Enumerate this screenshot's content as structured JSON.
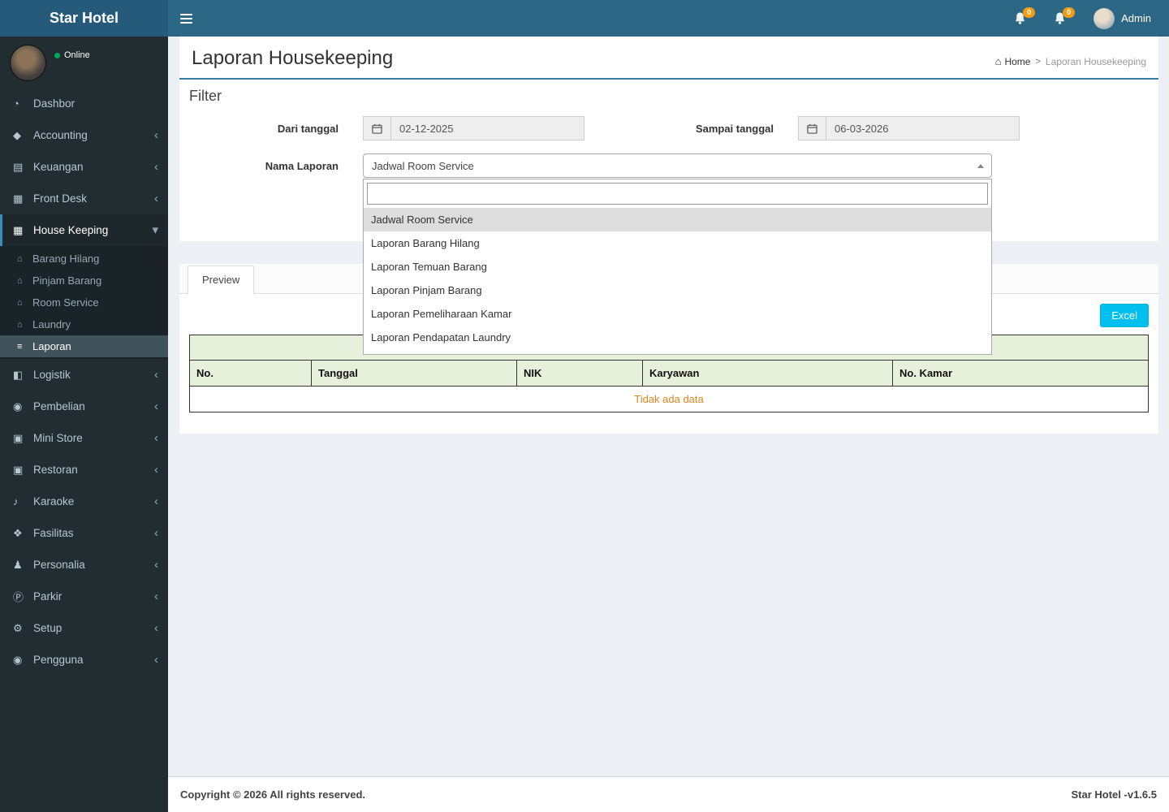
{
  "navbar": {
    "brand": "Star Hotel",
    "notifications": [
      {
        "count": "0"
      },
      {
        "count": "0"
      }
    ],
    "user_label": "Admin"
  },
  "sidebar": {
    "online_label": "Online",
    "items_top": [
      {
        "label": "Dashbor",
        "glyph": "◔",
        "chevron": ""
      },
      {
        "label": "Accounting",
        "glyph": "◆",
        "chevron": "‹"
      },
      {
        "label": "Keuangan",
        "glyph": "▤",
        "chevron": "‹"
      },
      {
        "label": "Front Desk",
        "glyph": "▦",
        "chevron": "‹"
      }
    ],
    "housekeeping": {
      "label": "House Keeping",
      "glyph": "▦",
      "chevron": "▾"
    },
    "housekeeping_children": [
      {
        "label": "Barang Hilang",
        "glyph": "⌂"
      },
      {
        "label": "Pinjam Barang",
        "glyph": "⌂"
      },
      {
        "label": "Room Service",
        "glyph": "⌂"
      },
      {
        "label": "Laundry",
        "glyph": "⌂"
      },
      {
        "label": "Laporan",
        "glyph": "≡",
        "active": true
      }
    ],
    "items_bottom": [
      {
        "label": "Logistik",
        "glyph": "◧",
        "chevron": "‹"
      },
      {
        "label": "Pembelian",
        "glyph": "◉",
        "chevron": "‹"
      },
      {
        "label": "Mini Store",
        "glyph": "▣",
        "chevron": "‹"
      },
      {
        "label": "Restoran",
        "glyph": "▣",
        "chevron": "‹"
      },
      {
        "label": "Karaoke",
        "glyph": "♪",
        "chevron": "‹"
      },
      {
        "label": "Fasilitas",
        "glyph": "❖",
        "chevron": "‹"
      },
      {
        "label": "Personalia",
        "glyph": "♟",
        "chevron": "‹"
      },
      {
        "label": "Parkir",
        "glyph": "Ⓟ",
        "chevron": "‹"
      },
      {
        "label": "Setup",
        "glyph": "⚙",
        "chevron": "‹"
      },
      {
        "label": "Pengguna",
        "glyph": "◉",
        "chevron": "‹"
      }
    ]
  },
  "page": {
    "title": "Laporan Housekeeping",
    "breadcrumb": {
      "home": "Home",
      "separator": ">",
      "current": "Laporan Housekeeping"
    }
  },
  "filter": {
    "title": "Filter",
    "from_label": "Dari tanggal",
    "from_value": "02-12-2025",
    "to_label": "Sampai tanggal",
    "to_value": "06-03-2026",
    "report_label": "Nama Laporan",
    "selected_report": "Jadwal Room Service",
    "search_value": "",
    "options": [
      {
        "label": "Jadwal Room Service",
        "active": true
      },
      {
        "label": "Laporan Barang Hilang"
      },
      {
        "label": "Laporan Temuan Barang"
      },
      {
        "label": "Laporan Pinjam Barang"
      },
      {
        "label": "Laporan Pemeliharaan Kamar"
      },
      {
        "label": "Laporan Pendapatan Laundry"
      }
    ]
  },
  "preview": {
    "tab_label": "Preview",
    "excel_label": "Excel",
    "table": {
      "headers": [
        {
          "label": "No."
        },
        {
          "label": "Tanggal"
        },
        {
          "label": "NIK"
        },
        {
          "label": "Karyawan"
        },
        {
          "label": "No. Kamar"
        }
      ],
      "empty_text": "Tidak ada data"
    }
  },
  "footer": {
    "left": "Copyright © 2026 All rights reserved.",
    "right": "Star Hotel -v1.6.5"
  },
  "colors": {
    "accent": "#3c8dbc",
    "navbar": "#2c6886",
    "sidebar": "#222d32",
    "excel_button": "#00c0ef",
    "table_header_bg": "#e7f0db",
    "empty_text": "#e0861f",
    "online_dot": "#00a65a",
    "badge": "#f39c12"
  }
}
